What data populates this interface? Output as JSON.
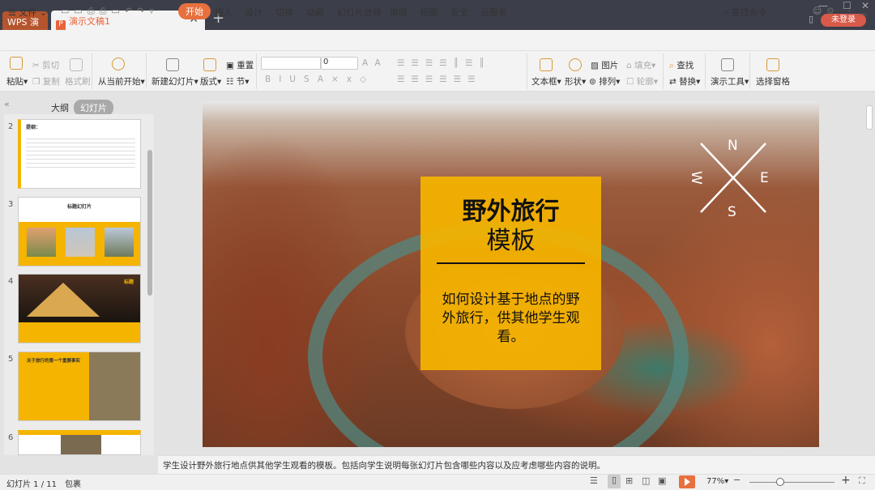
{
  "titlebar": {
    "app_tab": "WPS 演示",
    "doc_tab": "演示文稿1",
    "login": "未登录"
  },
  "menu": {
    "file": "文件",
    "tabs": [
      "开始",
      "插入",
      "设计",
      "切换",
      "动画",
      "幻灯片放映",
      "审阅",
      "视图",
      "安全",
      "云服务"
    ],
    "search": "查找命令"
  },
  "ribbon": {
    "paste": "粘贴",
    "cut": "剪切",
    "copy": "复制",
    "format_painter": "格式刷",
    "from_current": "从当前开始",
    "new_slide": "新建幻灯片",
    "layout": "版式",
    "reset": "重置",
    "section": "节",
    "font_size": "0",
    "textbox": "文本框",
    "shape": "形状",
    "picture": "图片",
    "arrange": "排列",
    "fill": "填充",
    "outline": "轮廓",
    "find": "查找",
    "replace": "替换",
    "present_tools": "演示工具",
    "select_pane": "选择窗格"
  },
  "panel": {
    "tab_outline": "大纲",
    "tab_slides": "幻灯片",
    "thumbs": [
      {
        "num": "2",
        "title": "提纲："
      },
      {
        "num": "3",
        "title": "标题幻灯片"
      },
      {
        "num": "4",
        "title": "标题"
      },
      {
        "num": "5",
        "title": "关于旅行的第一个重要事实"
      },
      {
        "num": "6",
        "title": ""
      }
    ]
  },
  "slide": {
    "title_line1": "野外旅行",
    "title_line2": "模板",
    "subtitle": "如何设计基于地点的野外旅行，供其他学生观看。",
    "compass": {
      "n": "N",
      "e": "E",
      "s": "S",
      "w": "W"
    }
  },
  "notes": "学生设计野外旅行地点供其他学生观看的模板。包括向学生说明每张幻灯片包含哪些内容以及应考虑哪些内容的说明。",
  "status": {
    "slide_count": "幻灯片 1 / 11",
    "theme": "包裹",
    "zoom": "77%"
  }
}
